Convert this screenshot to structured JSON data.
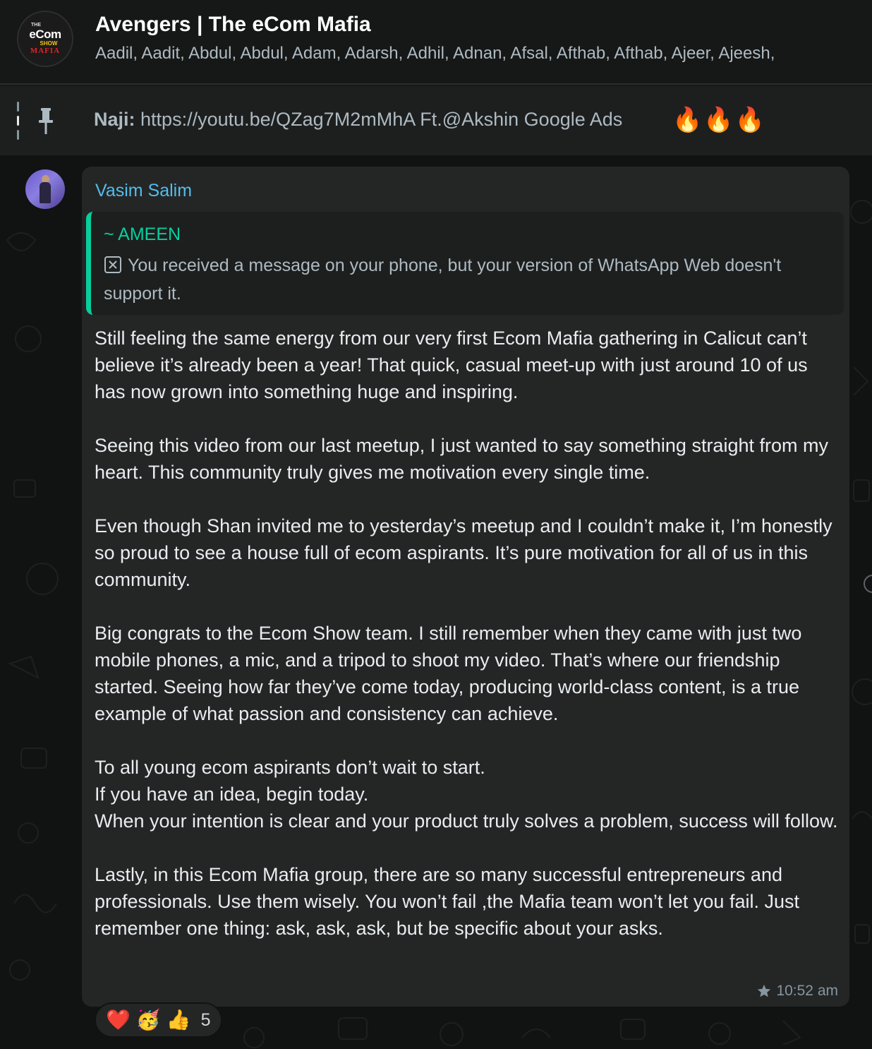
{
  "header": {
    "group_name": "Avengers | The eCom Mafia",
    "members": "Aadil, Aadit, Abdul, Abdul, Adam, Adarsh, Adhil, Adnan, Afsal, Afthab, Afthab, Ajeer, Ajeesh,",
    "avatar_logo": {
      "the": "THE",
      "ecom": "eCom",
      "show": "SHOW",
      "mafia": "MAFIA"
    }
  },
  "pinned": {
    "icon": "pin-icon",
    "sender": "Naji:",
    "text": "https://youtu.be/QZag7M2mMhA Ft.@Akshin Google Ads",
    "emojis": "🔥🔥🔥"
  },
  "message": {
    "sender": "Vasim Salim",
    "quote": {
      "author": "~ AMEEN",
      "icon": "blocked-message-icon",
      "text": "You received a message on your phone, but your version of WhatsApp Web doesn't support it."
    },
    "body": "Still feeling the same energy from our very first Ecom Mafia gathering in Calicut can’t believe it’s already been a year! That quick, casual meet-up with just around 10 of us has now grown into something huge and inspiring.\n\nSeeing this video from our last meetup, I just wanted to say something straight from my heart. This community truly gives me motivation every single time.\n\nEven though Shan invited me to yesterday’s meetup and I couldn’t make it, I’m honestly so proud to see a house full of ecom aspirants. It’s pure motivation for all of us in this community.\n\nBig congrats to the Ecom Show team. I still remember when they came with just two mobile phones, a mic, and a tripod to shoot my video. That’s where our friendship started. Seeing how far they’ve come today, producing world-class content, is a true example of what passion and consistency can achieve.\n\nTo all young ecom aspirants don’t wait to start.\nIf you have an idea, begin today.\nWhen your intention is clear and your product truly solves a problem, success will follow.\n\nLastly, in this Ecom Mafia group, there are so many successful entrepreneurs and professionals. Use them wisely. You won’t fail ,the Mafia team won’t let you fail. Just remember one thing: ask, ask, ask, but be specific about your asks.",
    "time": "10:52 am",
    "starred": true,
    "reactions": {
      "emojis": [
        "❤️",
        "🥳",
        "👍"
      ],
      "count": "5"
    }
  },
  "colors": {
    "header_bg": "#161717",
    "chat_bg": "#111212",
    "bubble_bg": "#242626",
    "sender_name": "#53bdeb",
    "quote_accent": "#06cf9c",
    "secondary_text": "#aebac1"
  }
}
